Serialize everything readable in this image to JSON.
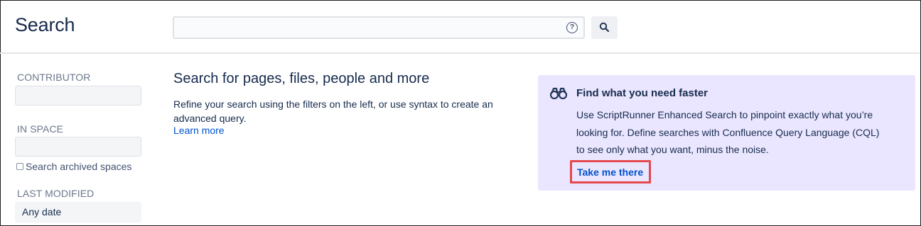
{
  "header": {
    "title": "Search",
    "search": {
      "value": "",
      "placeholder": "",
      "help_icon": "?"
    },
    "search_button_icon": "search-icon"
  },
  "sidebar": {
    "contributor_label": "CONTRIBUTOR",
    "space_label": "IN SPACE",
    "archived_label": "Search archived spaces",
    "modified_label": "LAST MODIFIED",
    "modified_value": "Any date"
  },
  "main": {
    "heading": "Search for pages, files, people and more",
    "body": "Refine your search using the filters on the left, or use syntax to create an advanced query.",
    "link": "Learn more"
  },
  "promo": {
    "icon": "binoculars-icon",
    "title": "Find what you need faster",
    "text": "Use ScriptRunner Enhanced Search to pinpoint exactly what you’re looking for. Define searches with Confluence Query Language (CQL) to see only what you want, minus the noise.",
    "link": "Take me there",
    "background": "#eae6ff",
    "highlight_color": "#e5484d"
  }
}
